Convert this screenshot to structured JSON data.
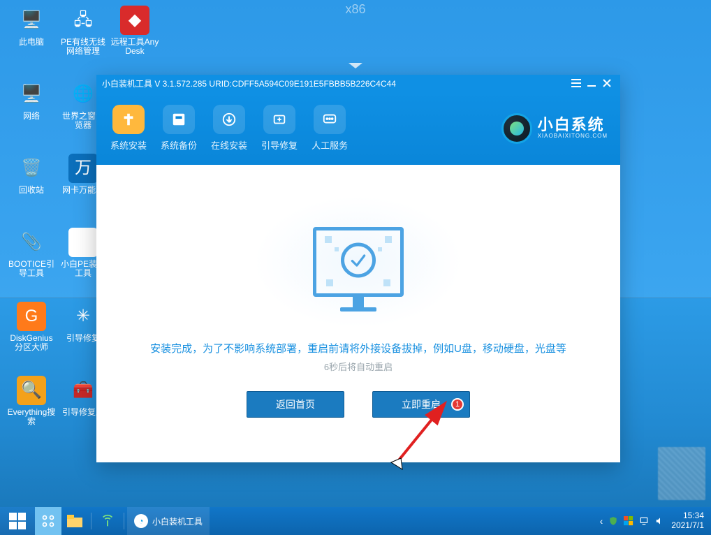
{
  "x86_label": "x86",
  "desktop_icons": [
    {
      "label": "此电脑",
      "glyph": "🖥️",
      "bg": ""
    },
    {
      "label": "PE有线无线网络管理",
      "glyph": "🖧",
      "bg": ""
    },
    {
      "label": "远程工具AnyDesk",
      "glyph": "◆",
      "bg": "#d92b2b"
    },
    {
      "label": "网络",
      "glyph": "🖥️",
      "bg": ""
    },
    {
      "label": "世界之窗浏览器",
      "glyph": "🌐",
      "bg": ""
    },
    {
      "label": "",
      "glyph": "",
      "bg": ""
    },
    {
      "label": "回收站",
      "glyph": "🗑️",
      "bg": ""
    },
    {
      "label": "网卡万能驱",
      "glyph": "万",
      "bg": "#0b6fbb"
    },
    {
      "label": "",
      "glyph": "",
      "bg": ""
    },
    {
      "label": "BOOTICE引导工具",
      "glyph": "📎",
      "bg": ""
    },
    {
      "label": "小白PE装机工具",
      "glyph": "◔",
      "bg": "#fff"
    },
    {
      "label": "",
      "glyph": "",
      "bg": ""
    },
    {
      "label": "DiskGenius分区大师",
      "glyph": "G",
      "bg": "#ff7a1a"
    },
    {
      "label": "引导修复",
      "glyph": "✳",
      "bg": ""
    },
    {
      "label": "",
      "glyph": "",
      "bg": ""
    },
    {
      "label": "Everything搜索",
      "glyph": "🔍",
      "bg": "#f3a11a"
    },
    {
      "label": "引导修复工",
      "glyph": "🧰",
      "bg": ""
    },
    {
      "label": "",
      "glyph": "",
      "bg": ""
    }
  ],
  "appwin": {
    "title": "小白装机工具 V 3.1.572.285 URID:CDFF5A594C09E191E5FBBB5B226C4C44",
    "toolbar": [
      {
        "label": "系统安装"
      },
      {
        "label": "系统备份"
      },
      {
        "label": "在线安装"
      },
      {
        "label": "引导修复"
      },
      {
        "label": "人工服务"
      }
    ],
    "brand_cn": "小白系统",
    "brand_en": "XIAOBAIXITONG.COM",
    "message": "安装完成，为了不影响系统部署，重启前请将外接设备拔掉，例如U盘，移动硬盘，光盘等",
    "countdown": "6秒后将自动重启",
    "back_label": "返回首页",
    "restart_label": "立即重启",
    "badge": "1"
  },
  "taskbar": {
    "app_label": "小白装机工具",
    "time": "15:34",
    "date": "2021/7/1"
  }
}
